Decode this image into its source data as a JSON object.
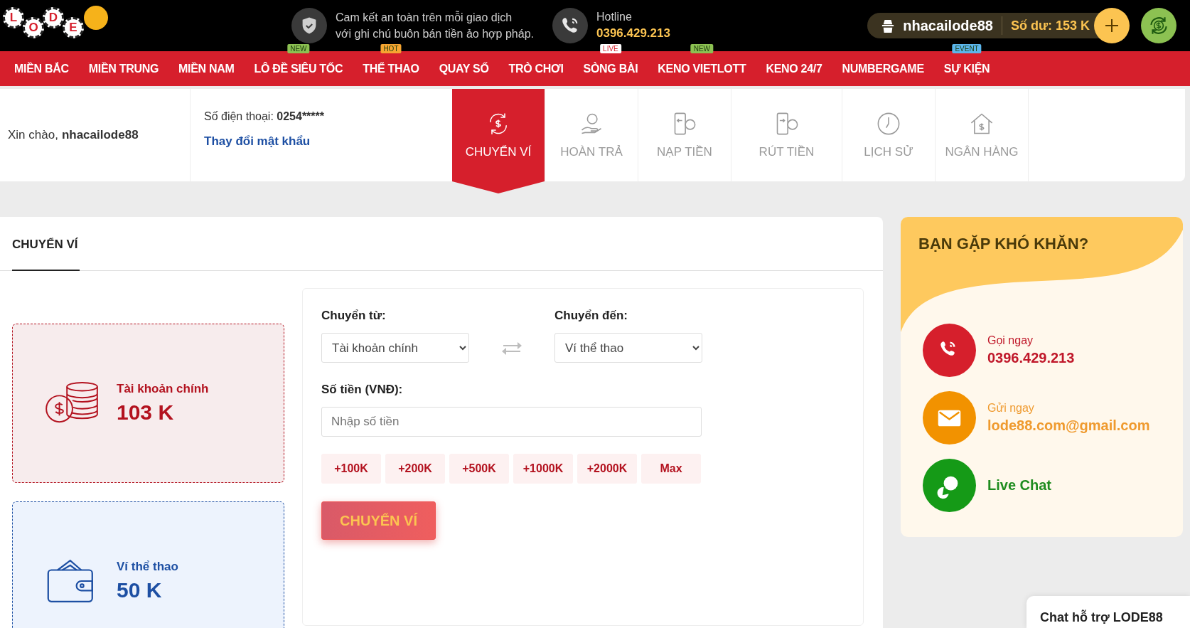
{
  "header": {
    "logo_letters": [
      "L",
      "O",
      "D",
      "E"
    ],
    "trust_text": [
      "Cam kết an toàn trên mỗi giao dịch",
      "với ghi chú buôn bán tiền ảo hợp pháp."
    ],
    "hotline": {
      "label": "Hotline",
      "number": "0396.429.213"
    },
    "account": {
      "username": "nhacailode88",
      "balance": "Số dư: 153 K"
    }
  },
  "nav": [
    {
      "label": "MIỀN BẮC"
    },
    {
      "label": "MIỀN TRUNG"
    },
    {
      "label": "MIỀN NAM"
    },
    {
      "label": "LÔ ĐỀ SIÊU TỐC",
      "badge": {
        "text": "NEW",
        "color": "#8cc152"
      }
    },
    {
      "label": "THỂ THAO",
      "badge": {
        "text": "HOT",
        "color": "#f6a531"
      }
    },
    {
      "label": "QUAY SỐ"
    },
    {
      "label": "TRÒ CHƠI"
    },
    {
      "label": "SÒNG BÀI",
      "badge": {
        "text": "LIVE",
        "color": "#ffffff"
      }
    },
    {
      "label": "KENO VIETLOTT",
      "badge": {
        "text": "NEW",
        "color": "#8cc152"
      }
    },
    {
      "label": "KENO 24/7"
    },
    {
      "label": "NUMBERGAME"
    },
    {
      "label": "SỰ KIỆN",
      "badge": {
        "text": "EVENT",
        "color": "#5bb6ec"
      }
    }
  ],
  "profile": {
    "greeting": "Xin chào,",
    "username": "nhacailode88",
    "phone_label": "Số điện thoại:",
    "phone": "0254*****",
    "change_password": "Thay đổi mật khẩu"
  },
  "account_tabs": [
    {
      "label": "CHUYỂN VÍ",
      "kind": "transfer",
      "selected": true
    },
    {
      "label": "HOÀN TRẢ",
      "kind": "refund",
      "selected": false
    },
    {
      "label": "NẠP TIỀN",
      "kind": "deposit",
      "selected": false
    },
    {
      "label": "RÚT TIỀN",
      "kind": "withdraw",
      "selected": false
    },
    {
      "label": "LỊCH SỬ",
      "kind": "history",
      "selected": false
    },
    {
      "label": "NGÂN HÀNG",
      "kind": "bank",
      "selected": false
    }
  ],
  "section_tab": "CHUYỂN VÍ",
  "wallets": [
    {
      "kind": "main",
      "name": "Tài khoản chính",
      "amount": "103 K"
    },
    {
      "kind": "sport",
      "name": "Ví thể thao",
      "amount": "50 K"
    }
  ],
  "form": {
    "from_label": "Chuyển từ:",
    "from_value": "Tài khoản chính",
    "to_label": "Chuyển đến:",
    "to_value": "Ví thể thao",
    "amount_label": "Số tiền (VNĐ):",
    "amount_placeholder": "Nhập số tiền",
    "quick_amounts": [
      "+100K",
      "+200K",
      "+500K",
      "+1000K",
      "+2000K",
      "Max"
    ],
    "submit": "CHUYỂN VÍ"
  },
  "help": {
    "title": "BẠN GẶP KHÓ KHĂN?",
    "contacts": [
      {
        "kind": "call",
        "label": "Gọi ngay",
        "value": "0396.429.213"
      },
      {
        "kind": "mail",
        "label": "Gửi ngay",
        "value": "lode88.com@gmail.com"
      },
      {
        "kind": "chat",
        "value": "Live Chat"
      }
    ]
  },
  "chat_widget": "Chat hỗ trợ LODE88"
}
